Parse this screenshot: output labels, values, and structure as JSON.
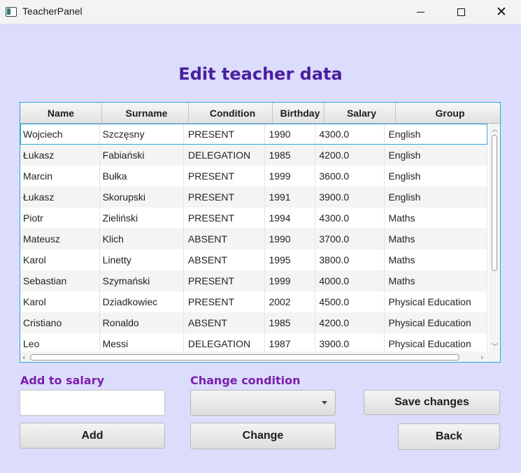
{
  "window": {
    "title": "TeacherPanel"
  },
  "heading": "Edit teacher data",
  "table": {
    "columns": [
      "Name",
      "Surname",
      "Condition",
      "Birthday",
      "Salary",
      "Group"
    ],
    "rows": [
      [
        "Wojciech",
        "Szczęsny",
        "PRESENT",
        "1990",
        "4300.0",
        "English"
      ],
      [
        "Łukasz",
        "Fabiański",
        "DELEGATION",
        "1985",
        "4200.0",
        "English"
      ],
      [
        "Marcin",
        "Bułka",
        "PRESENT",
        "1999",
        "3600.0",
        "English"
      ],
      [
        "Łukasz",
        "Skorupski",
        "PRESENT",
        "1991",
        "3900.0",
        "English"
      ],
      [
        "Piotr",
        "Zieliński",
        "PRESENT",
        "1994",
        "4300.0",
        "Maths"
      ],
      [
        "Mateusz",
        "Klich",
        "ABSENT",
        "1990",
        "3700.0",
        "Maths"
      ],
      [
        "Karol",
        "Linetty",
        "ABSENT",
        "1995",
        "3800.0",
        "Maths"
      ],
      [
        "Sebastian",
        "Szymański",
        "PRESENT",
        "1999",
        "4000.0",
        "Maths"
      ],
      [
        "Karol",
        "Dziadkowiec",
        "PRESENT",
        "2002",
        "4500.0",
        "Physical Education"
      ],
      [
        "Cristiano",
        "Ronaldo",
        "ABSENT",
        "1985",
        "4200.0",
        "Physical Education"
      ],
      [
        "Leo",
        "Messi",
        "DELEGATION",
        "1987",
        "3900.0",
        "Physical Education"
      ]
    ]
  },
  "salary": {
    "label": "Add to salary",
    "value": "",
    "button": "Add"
  },
  "condition": {
    "label": "Change condition",
    "selected": "",
    "button": "Change"
  },
  "actions": {
    "save": "Save changes",
    "back": "Back"
  },
  "colors": {
    "background": "#dcdcfc",
    "heading": "#4a1e9e",
    "label": "#7a1eaa",
    "table_border": "#2aa8d8"
  },
  "icons": {
    "app": "app-window-icon",
    "minimize": "minimize-icon",
    "maximize": "maximize-icon",
    "close": "close-icon",
    "dropdown": "chevron-down-icon"
  }
}
